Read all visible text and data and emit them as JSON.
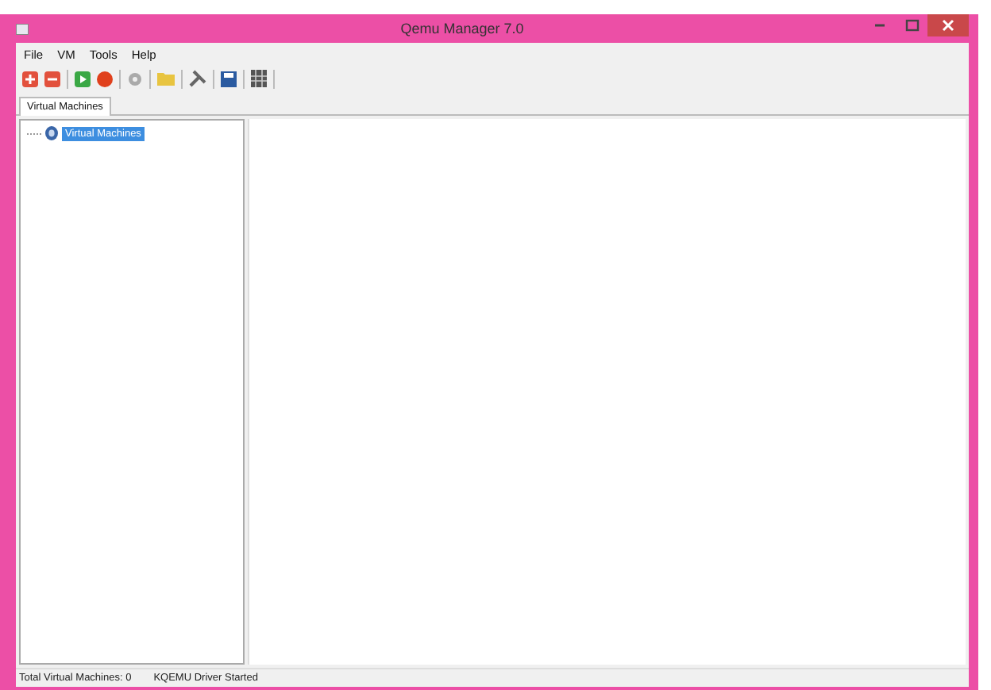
{
  "window": {
    "title": "Qemu Manager 7.0"
  },
  "menu": [
    "File",
    "VM",
    "Tools",
    "Help"
  ],
  "tabs": [
    {
      "label": "Virtual Machines",
      "selected": true
    }
  ],
  "tree": [
    {
      "label": "Virtual Machines",
      "selected": true
    }
  ],
  "status_bar": [
    "Total Virtual Machines: 0",
    "KQEMU Driver Started"
  ]
}
